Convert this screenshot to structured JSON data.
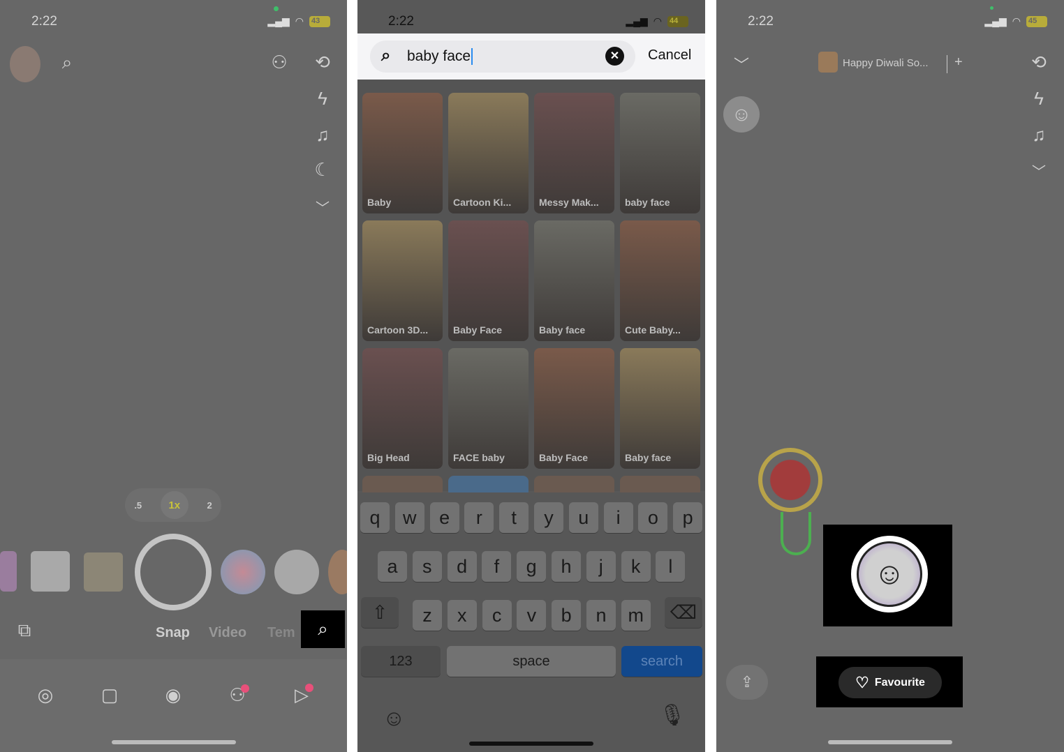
{
  "left": {
    "time": "2:22",
    "battery": "43",
    "icons": [
      "avatar",
      "search-icon",
      "add-friend-icon",
      "flip-camera-icon",
      "flash-off-icon",
      "music-icon",
      "night-mode-icon",
      "chevron-down-icon"
    ],
    "zoom": [
      ".5",
      "1x",
      "2"
    ],
    "modes": [
      "Snap",
      "Video",
      "Tem"
    ],
    "nav": [
      "map-icon",
      "chat-icon",
      "camera-icon",
      "friends-icon",
      "stories-icon"
    ],
    "accent": "#e8507a"
  },
  "middle": {
    "time": "2:22",
    "battery": "44",
    "search_value": "baby face",
    "cancel": "Cancel",
    "results": [
      "Baby",
      "Cartoon Ki...",
      "Messy Mak...",
      "baby face",
      "Cartoon 3D...",
      "Baby Face",
      "Baby face",
      "Cute Baby...",
      "Big Head",
      "FACE baby",
      "Baby Face",
      "Baby face"
    ],
    "keyboard": {
      "row1": [
        "q",
        "w",
        "e",
        "r",
        "t",
        "y",
        "u",
        "i",
        "o",
        "p"
      ],
      "row2": [
        "a",
        "s",
        "d",
        "f",
        "g",
        "h",
        "j",
        "k",
        "l"
      ],
      "row3": [
        "z",
        "x",
        "c",
        "v",
        "b",
        "n",
        "m"
      ],
      "numbers": "123",
      "space": "space",
      "search": "search"
    }
  },
  "right": {
    "time": "2:22",
    "battery": "45",
    "song": "Happy Diwali So...",
    "plus": "+",
    "favourite": "Favourite"
  }
}
